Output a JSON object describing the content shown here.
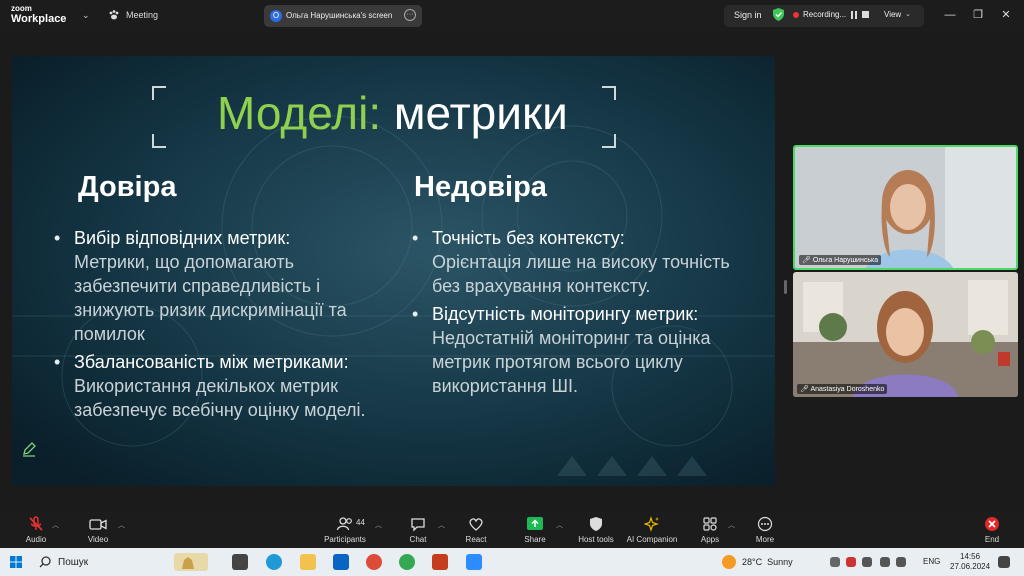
{
  "app": {
    "logo_line1": "zoom",
    "logo_line2": "Workplace",
    "meeting_label": "Meeting"
  },
  "share": {
    "avatar_letter": "O",
    "screen_label": "Ольга Нарушинська's screen"
  },
  "topbar_right": {
    "signin": "Sign in",
    "recording": "Recording...",
    "view": "View"
  },
  "slide": {
    "title_accent": "Моделі:",
    "title_rest": " метрики",
    "left": {
      "heading": "Довіра",
      "items": [
        {
          "head": "Вибір відповідних метрик:",
          "body": "Метрики, що допомагають забезпечити справедливість і знижують ризик дискримінації та помилок"
        },
        {
          "head": "Збалансованість між метриками:",
          "body": "Використання декількох метрик забезпечує всебічну оцінку моделі."
        }
      ]
    },
    "right": {
      "heading": "Недовіра",
      "items": [
        {
          "head": "Точність без контексту:",
          "body": "Орієнтація лише на високу точність без врахування контексту."
        },
        {
          "head": "Відсутність моніторингу метрик:",
          "body": "Недостатній моніторинг та оцінка метрик протягом всього циклу використання ШІ."
        }
      ]
    }
  },
  "participants_tiles": [
    {
      "name": "Ольга Нарушинська"
    },
    {
      "name": "Anastasiya Doroshenko"
    }
  ],
  "toolbar": {
    "audio": "Audio",
    "video": "Video",
    "participants": "Participants",
    "participants_count": "44",
    "chat": "Chat",
    "react": "React",
    "share": "Share",
    "host_tools": "Host tools",
    "ai_companion": "AI Companion",
    "apps": "Apps",
    "more": "More",
    "end": "End"
  },
  "taskbar": {
    "search": "Пошук",
    "temperature": "28°C",
    "weather": "Sunny",
    "lang": "ENG",
    "time": "14:56",
    "date": "27.06.2024"
  }
}
